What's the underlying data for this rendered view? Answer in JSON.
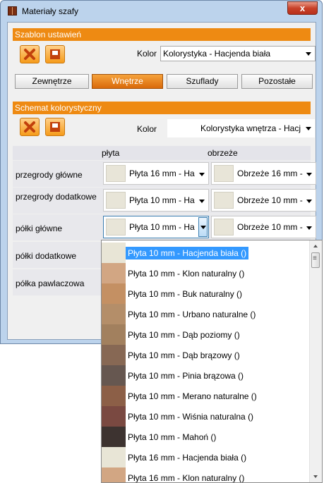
{
  "window": {
    "title": "Materiały szafy",
    "close": "x"
  },
  "template": {
    "header": "Szablon ustawień",
    "color_label": "Kolor",
    "color_value": "Kolorystyka - Hacjenda biała"
  },
  "tabs": [
    {
      "label": "Zewnętrze",
      "active": false
    },
    {
      "label": "Wnętrze",
      "active": true
    },
    {
      "label": "Szuflady",
      "active": false
    },
    {
      "label": "Pozostałe",
      "active": false
    }
  ],
  "scheme": {
    "header": "Schemat kolorystyczny",
    "color_label": "Kolor",
    "color_value": "Kolorystyka wnętrza - Hacj"
  },
  "grid": {
    "col_plate": "płyta",
    "col_edge": "obrzeże",
    "rows": [
      {
        "label": "przegrody główne",
        "plate": "Płyta 16 mm - Ha",
        "edge": "Obrzeże 16 mm -"
      },
      {
        "label": "przegrody dodatkowe",
        "plate": "Płyta 10 mm - Ha",
        "edge": "Obrzeże 10 mm -"
      },
      {
        "label": "półki główne",
        "plate": "Płyta 10 mm - Ha",
        "edge": "Obrzeże 10 mm -"
      },
      {
        "label": "półki dodatkowe"
      },
      {
        "label": "półka pawlaczowa"
      }
    ]
  },
  "dropdown": {
    "items": [
      {
        "label": "Płyta 10 mm - Hacjenda biała ()",
        "color": "#e8e5d6",
        "selected": true
      },
      {
        "label": "Płyta 10 mm - Klon naturalny ()",
        "color": "#d2a683"
      },
      {
        "label": "Płyta 10 mm - Buk naturalny ()",
        "color": "#c49063"
      },
      {
        "label": "Płyta 10 mm - Urbano naturalne ()",
        "color": "#b48e69"
      },
      {
        "label": "Płyta 10 mm - Dąb poziomy ()",
        "color": "#a2805e"
      },
      {
        "label": "Płyta 10 mm - Dąb brązowy ()",
        "color": "#876854"
      },
      {
        "label": "Płyta 10 mm - Pinia brązowa ()",
        "color": "#665750"
      },
      {
        "label": "Płyta 10 mm - Merano naturalne ()",
        "color": "#8c5f47"
      },
      {
        "label": "Płyta 10 mm - Wiśnia naturalna ()",
        "color": "#7a4941"
      },
      {
        "label": "Płyta 10 mm - Mahoń ()",
        "color": "#3d3330"
      },
      {
        "label": "Płyta 16 mm - Hacjenda biała ()",
        "color": "#e8e5d6"
      },
      {
        "label": "Płyta 16 mm - Klon naturalny ()",
        "color": "#d2a683"
      }
    ]
  },
  "colors": {
    "accent": "#ee8a12",
    "selection": "#3399ff"
  }
}
